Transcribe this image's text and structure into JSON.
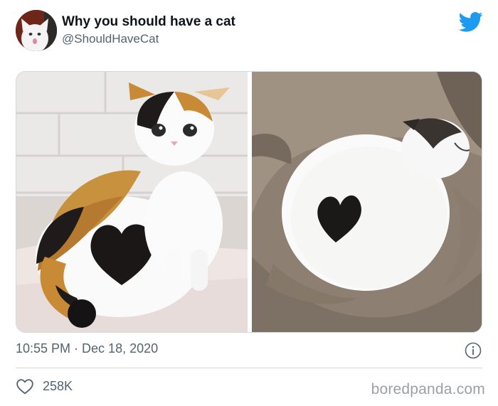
{
  "author": {
    "name": "Why you should have a cat",
    "handle": "@ShouldHaveCat"
  },
  "tweet": {
    "time": "10:55 PM",
    "separator": "·",
    "date": "Dec 18, 2020",
    "likes": "258K"
  },
  "icons": {
    "platform": "twitter-bird-icon",
    "info": "info-icon",
    "like": "heart-outline-icon"
  },
  "colors": {
    "brand": "#1d9bf0",
    "muted": "#536471",
    "watermark": "#9aa0a6"
  },
  "watermark": "boredpanda.com"
}
